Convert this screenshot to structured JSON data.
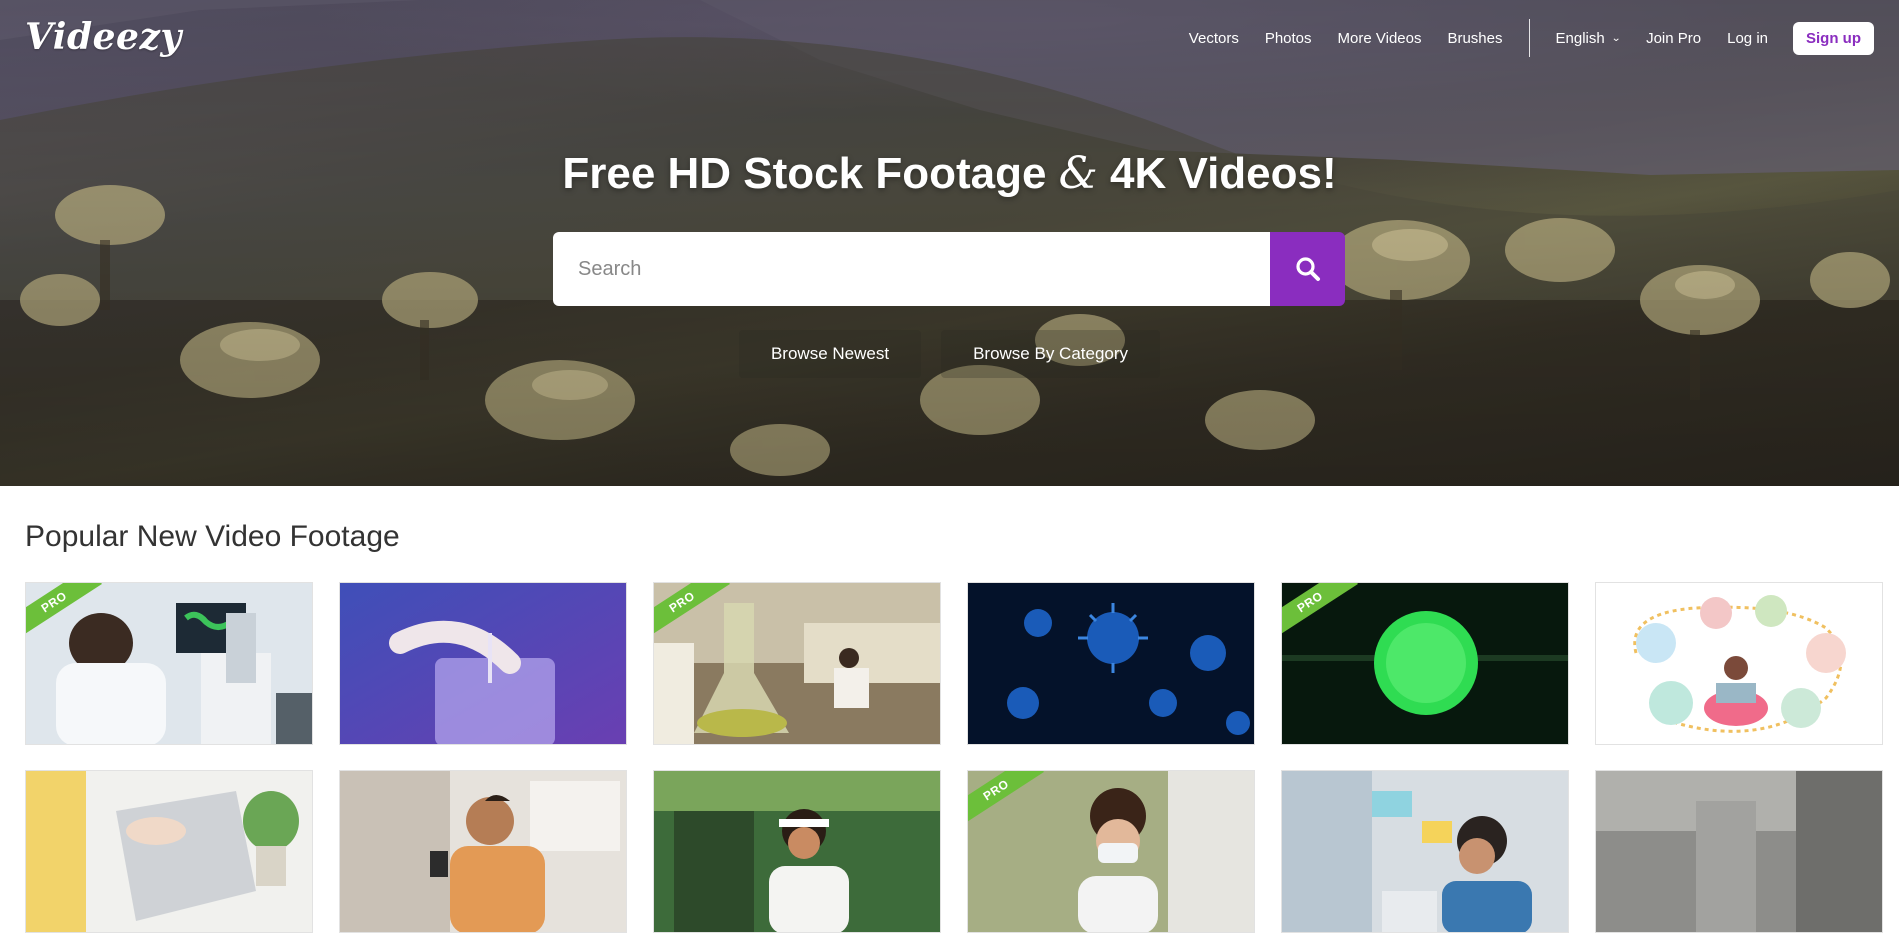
{
  "brand": {
    "logo_text": "Videezy"
  },
  "nav": {
    "links": [
      "Vectors",
      "Photos",
      "More Videos",
      "Brushes"
    ],
    "language": "English",
    "join_pro": "Join Pro",
    "login": "Log in",
    "signup": "Sign up"
  },
  "hero": {
    "headline_part1": "Free HD Stock Footage ",
    "headline_amp": "&",
    "headline_part2": " 4K Videos!",
    "search_placeholder": "Search",
    "browse_newest": "Browse Newest",
    "browse_category": "Browse By Category"
  },
  "section": {
    "title": "Popular New Video Footage"
  },
  "tiles": [
    {
      "pro": true,
      "badge": "PRO",
      "icon": "scientist-microscope-thumbnail"
    },
    {
      "pro": false,
      "badge": "",
      "icon": "lab-glassware-purple-thumbnail"
    },
    {
      "pro": true,
      "badge": "PRO",
      "icon": "laboratory-flask-thumbnail"
    },
    {
      "pro": false,
      "badge": "",
      "icon": "virus-blue-thumbnail"
    },
    {
      "pro": true,
      "badge": "PRO",
      "icon": "green-sphere-thumbnail"
    },
    {
      "pro": false,
      "badge": "",
      "icon": "online-shopping-illustration-thumbnail"
    },
    {
      "pro": false,
      "badge": "",
      "icon": "laptop-typing-thumbnail"
    },
    {
      "pro": false,
      "badge": "",
      "icon": "man-on-phone-sofa-thumbnail"
    },
    {
      "pro": false,
      "badge": "",
      "icon": "woman-drinking-coffee-thumbnail"
    },
    {
      "pro": true,
      "badge": "PRO",
      "icon": "woman-mask-thumbnail"
    },
    {
      "pro": false,
      "badge": "",
      "icon": "stressed-man-laptop-thumbnail"
    },
    {
      "pro": false,
      "badge": "",
      "icon": "gray-interior-thumbnail"
    }
  ],
  "colors": {
    "accent": "#8a2dbf",
    "pro_badge": "#6cbf3a"
  }
}
